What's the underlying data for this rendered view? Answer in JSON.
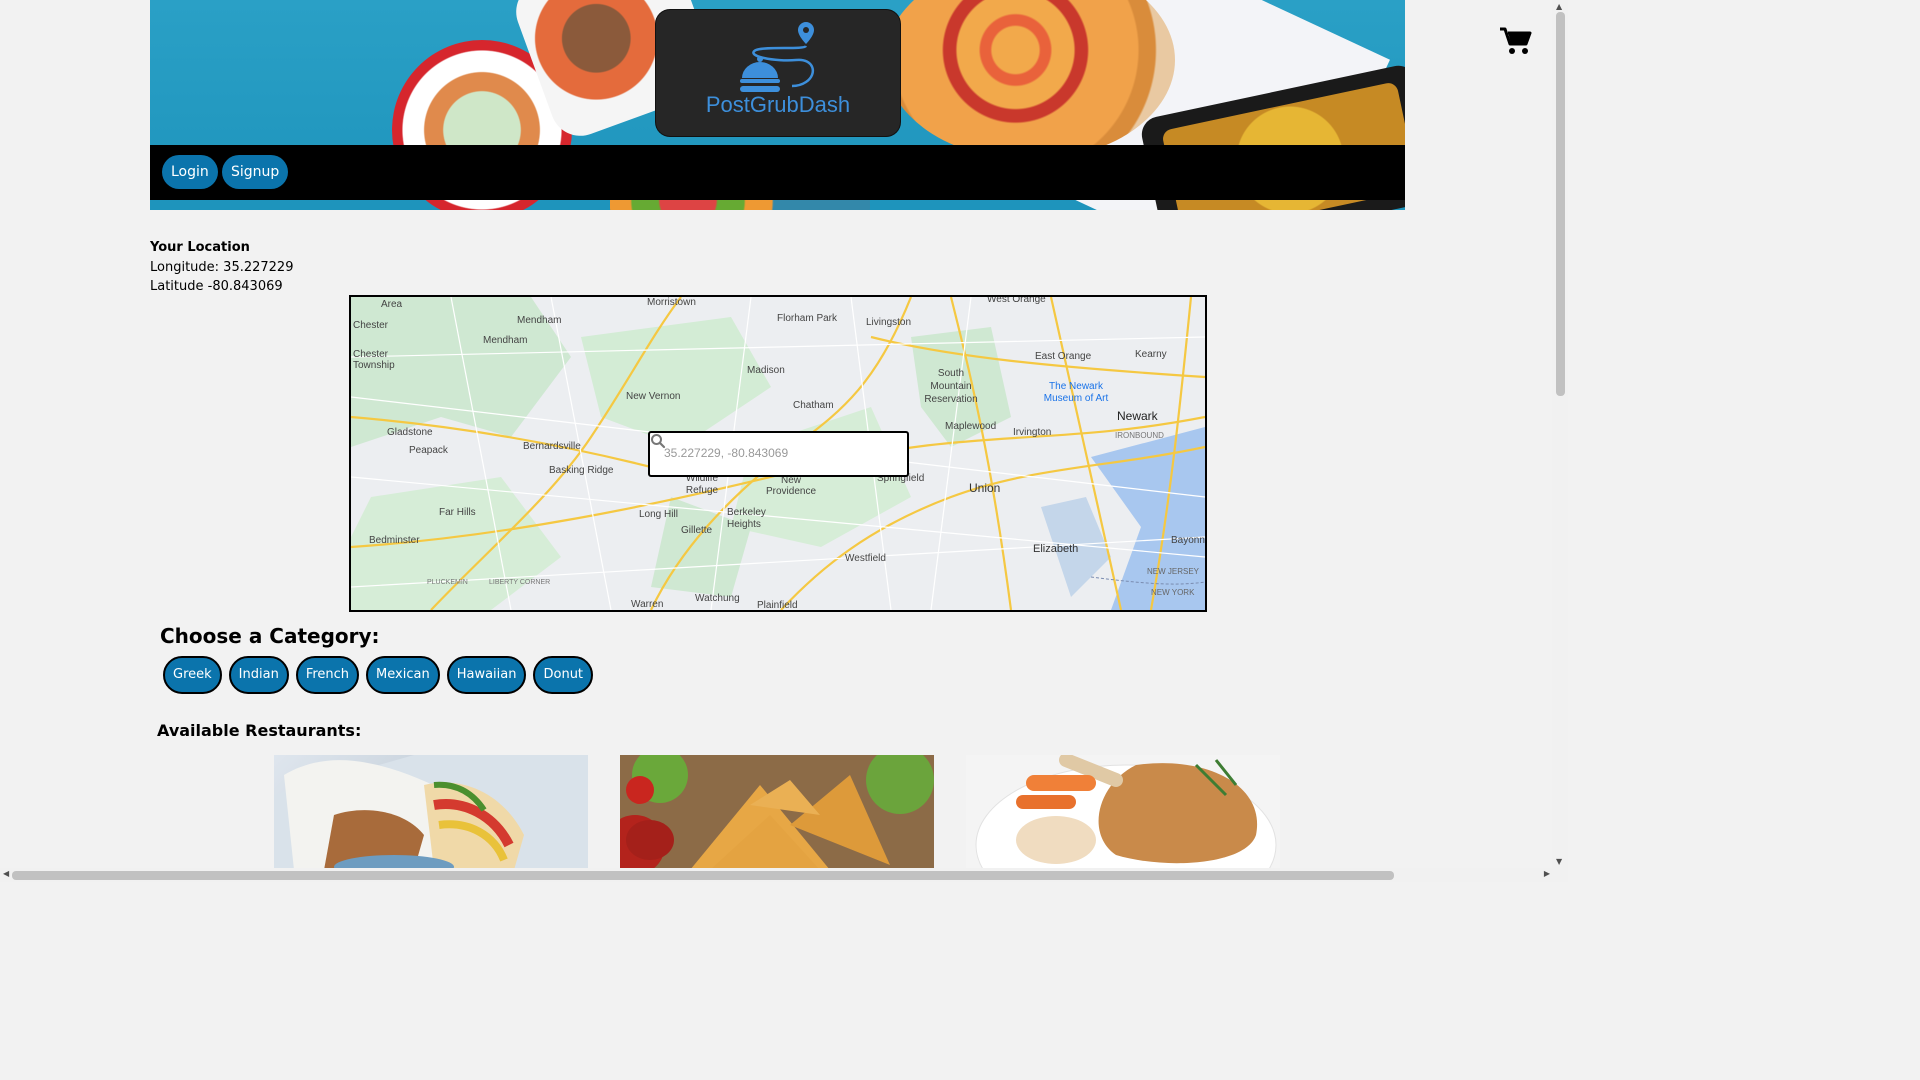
{
  "app": {
    "name": "PostGrubDash"
  },
  "nav": {
    "login_label": "Login",
    "signup_label": "Signup"
  },
  "location": {
    "title": "Your Location",
    "longitude_text": "Longitude: 35.227229",
    "latitude_text": "Latitude -80.843069"
  },
  "map": {
    "search_placeholder": "35.227229, -80.843069",
    "labels": [
      "Area",
      "Morristown",
      "West Orange",
      "Chester",
      "Mendham",
      "Mendham",
      "Florham Park",
      "Livingston",
      "Chester Township",
      "East Orange",
      "Kearny",
      "Madison",
      "South Mountain Reservation",
      "The Newark Museum of Art",
      "New Vernon",
      "Chatham",
      "Newark",
      "Gladstone",
      "Maplewood",
      "Irvington",
      "IRONBOUND",
      "Peapack",
      "Bernardsville",
      "Basking Ridge",
      "Wildlife Refuge",
      "New Providence",
      "Springfield",
      "Union",
      "Far Hills",
      "Long Hill",
      "Berkeley Heights",
      "Gillette",
      "Bedminster",
      "Westfield",
      "Elizabeth",
      "Bayonne",
      "PLUCKEMIN",
      "LIBERTY CORNER",
      "Warren",
      "Watchung",
      "Plainfield",
      "NEW JERSEY",
      "NEW YORK"
    ]
  },
  "categories": {
    "title": "Choose a Category:",
    "items": [
      "Greek",
      "Indian",
      "French",
      "Mexican",
      "Hawaiian",
      "Donut"
    ]
  },
  "restaurants": {
    "title": "Available Restaurants:"
  },
  "colors": {
    "accent": "#0b74ac",
    "logo": "#3d8fdb",
    "nav_bg": "#000000",
    "page_bg": "#f2f2f2"
  }
}
